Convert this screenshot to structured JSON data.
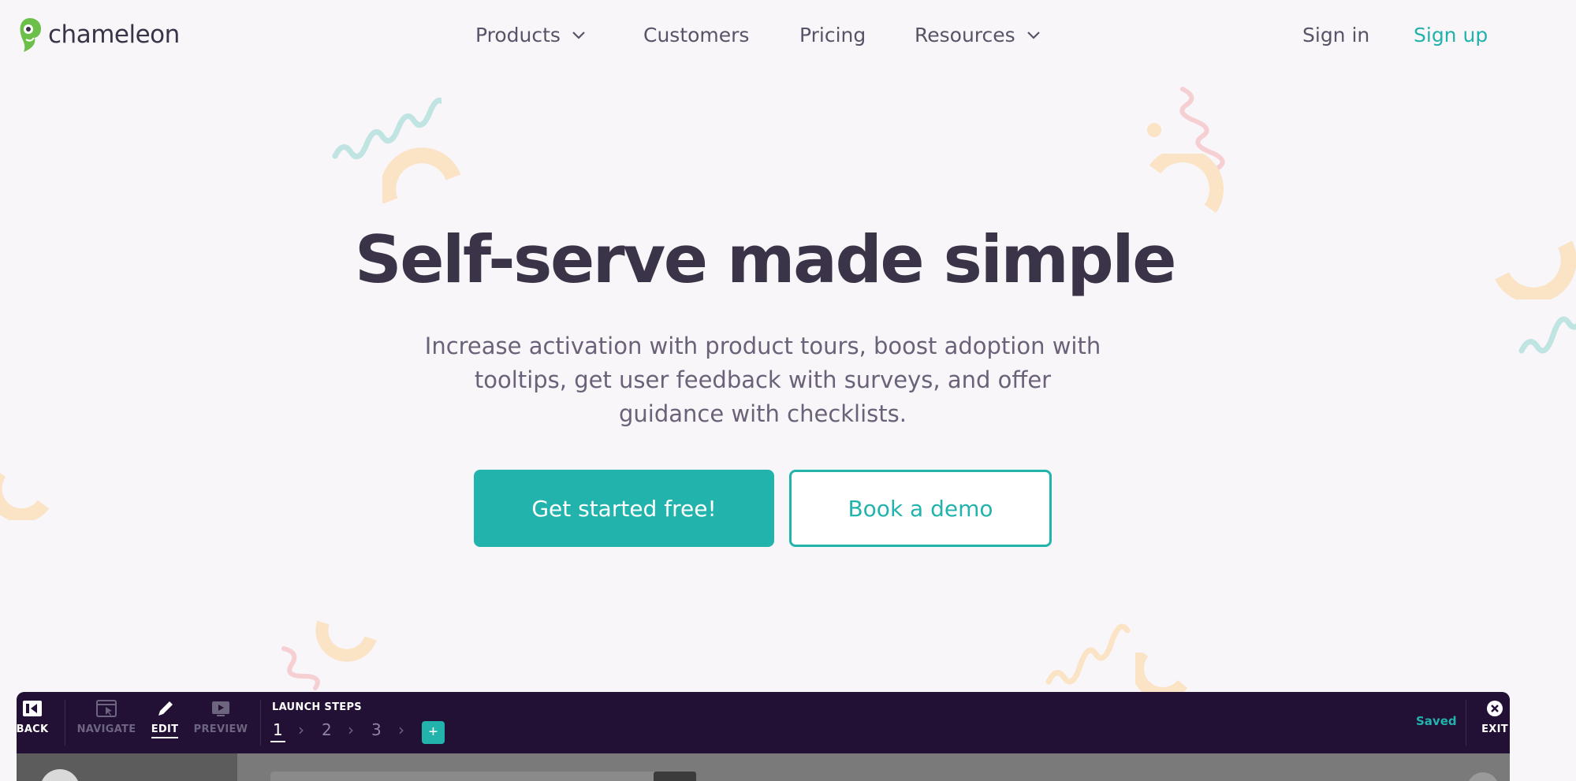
{
  "brand": {
    "name": "chameleon",
    "logo_icon": "chameleon-logo-icon",
    "accent": "#23b3ad",
    "dark": "#3b3347",
    "toolbar_bg": "#221035"
  },
  "nav": {
    "items": [
      {
        "label": "Products",
        "has_dropdown": true
      },
      {
        "label": "Customers",
        "has_dropdown": false
      },
      {
        "label": "Pricing",
        "has_dropdown": false
      },
      {
        "label": "Resources",
        "has_dropdown": true
      }
    ],
    "sign_in": "Sign in",
    "sign_up": "Sign up"
  },
  "hero": {
    "title": "Self-serve made simple",
    "subtitle": "Increase activation with product tours, boost adoption with tooltips, get user feedback with surveys, and offer guidance with checklists.",
    "cta_primary": "Get started free!",
    "cta_secondary": "Book a demo"
  },
  "editor": {
    "toolbar": {
      "back": "BACK",
      "navigate": "NAVIGATE",
      "edit": "EDIT",
      "preview": "PREVIEW",
      "steps_title": "LAUNCH STEPS",
      "steps": [
        "1",
        "2",
        "3"
      ],
      "active_step": "1",
      "add_step": "+",
      "status": "Saved",
      "exit": "EXIT"
    }
  }
}
